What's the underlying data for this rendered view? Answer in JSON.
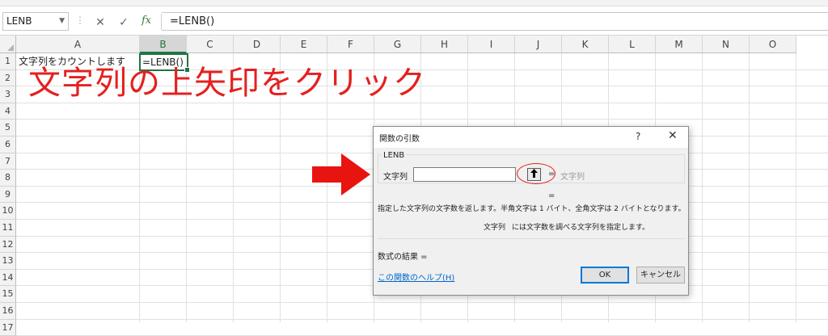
{
  "formula_bar": {
    "name_box": "LENB",
    "cancel_icon": "✕",
    "enter_icon": "✓",
    "fx_label": "fx",
    "formula": "=LENB()"
  },
  "sheet": {
    "columns": [
      "A",
      "B",
      "C",
      "D",
      "E",
      "F",
      "G",
      "H",
      "I",
      "J",
      "K",
      "L",
      "M",
      "N",
      "O"
    ],
    "rows": [
      "1",
      "2",
      "3",
      "4",
      "5",
      "6",
      "7",
      "8",
      "9",
      "10",
      "11",
      "12",
      "13",
      "14",
      "15",
      "16",
      "17"
    ],
    "selected_column": "B",
    "cell_A1": "文字列をカウントします",
    "cell_B1": "=LENB()"
  },
  "annotation": {
    "instruction": "文字列の上矢印をクリック",
    "color": "#e3211f"
  },
  "dialog": {
    "title": "関数の引数",
    "help_icon": "?",
    "close_icon": "✕",
    "function_name": "LENB",
    "arg_label": "文字列",
    "arg_value": "",
    "collapse_icon": "🠉",
    "equals1": "=",
    "arg_result": "文字列",
    "equals2": "=",
    "description": "指定した文字列の文字数を返します。半角文字は 1 バイト、全角文字は 2 バイトとなります。",
    "arg_desc_name": "文字列",
    "arg_desc": "には文字数を調べる文字列を指定します。",
    "result_label": "数式の結果 =",
    "help_link": "この関数のヘルプ(H)",
    "ok_label": "OK",
    "cancel_label": "キャンセル"
  }
}
